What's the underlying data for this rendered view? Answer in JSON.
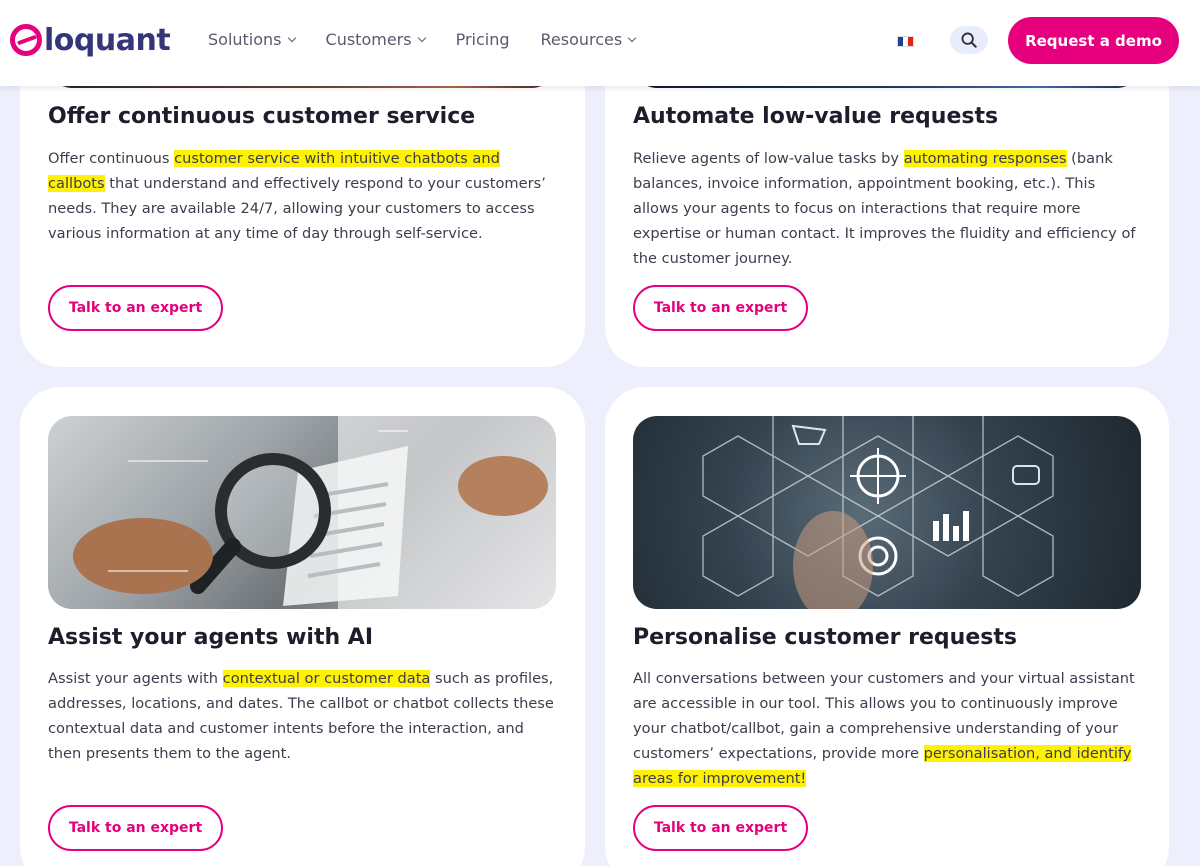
{
  "header": {
    "logo_text": "loquant",
    "nav": [
      {
        "label": "Solutions",
        "has_dropdown": true
      },
      {
        "label": "Customers",
        "has_dropdown": true
      },
      {
        "label": "Pricing",
        "has_dropdown": false
      },
      {
        "label": "Resources",
        "has_dropdown": true
      }
    ],
    "language_flag": "french-flag-icon",
    "search_icon": "search-icon",
    "demo_label": "Request a demo"
  },
  "colors": {
    "brand_pink": "#e6007e",
    "logo_navy": "#35357a",
    "page_bg": "#eeeffd",
    "highlight": "#fff200"
  },
  "cards": [
    {
      "title": "Offer continuous customer service",
      "text": {
        "before": "Offer continuous ",
        "highlight": "customer service with intuitive chatbots and callbots",
        "after": " that understand and effectively respond to your customers’ needs. They are available 24/7, allowing your customers to access various information at any time of day through self-service."
      },
      "button": "Talk to an expert"
    },
    {
      "title": "Automate low-value requests",
      "text": {
        "before": "Relieve agents of low-value tasks by ",
        "highlight": "automating responses",
        "after": " (bank balances, invoice information, appointment booking, etc.). This allows your agents to focus on interactions that require more expertise or human contact. It improves the fluidity and efficiency of the customer journey."
      },
      "button": "Talk to an expert"
    },
    {
      "title": "Assist your agents with AI",
      "text": {
        "before": "Assist your agents with ",
        "highlight": "contextual or customer data",
        "after": " such as profiles, addresses, locations, and dates. The callbot or chatbot collects these contextual data and customer intents before the interaction, and then presents them to the agent."
      },
      "button": "Talk to an expert"
    },
    {
      "title": "Personalise customer requests",
      "text": {
        "before": "All conversations between your customers and your virtual assistant are accessible in our tool. This allows you to continuously improve your chatbot/callbot, gain a comprehensive understanding of your customers’ expectations, provide more ",
        "highlight": "personalisation, and identify areas for improvement!",
        "after": ""
      },
      "button": "Talk to an expert"
    }
  ]
}
